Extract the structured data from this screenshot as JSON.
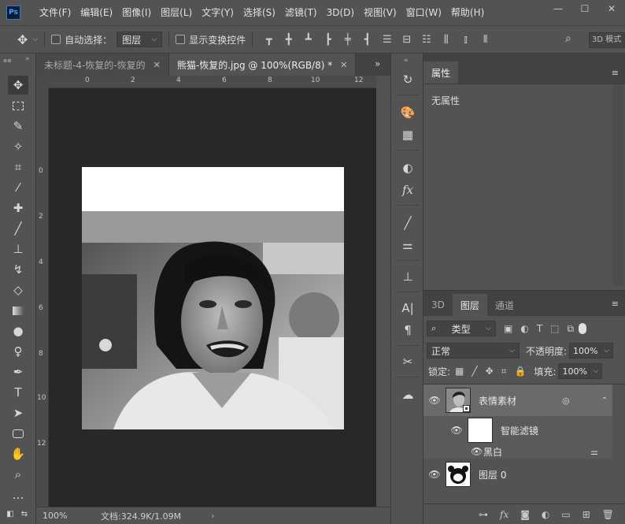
{
  "app": {
    "logo": "Ps",
    "menu": [
      "文件(F)",
      "编辑(E)",
      "图像(I)",
      "图层(L)",
      "文字(Y)",
      "选择(S)",
      "滤镜(T)",
      "3D(D)",
      "视图(V)",
      "窗口(W)",
      "帮助(H)"
    ],
    "window_controls": {
      "minimize": "—",
      "maximize": "☐",
      "close": "✕"
    }
  },
  "options": {
    "auto_select_label": "自动选择：",
    "auto_select_value": "图层",
    "show_transform_label": "显示变换控件",
    "three_d_label": "3D 模式"
  },
  "tabs": [
    {
      "label": "未标题-4-恢复的-恢复的",
      "close": "✕"
    },
    {
      "label": "熊猫-恢复的.jpg @ 100%(RGB/8) *",
      "close": "✕"
    }
  ],
  "tabs_more": "»",
  "ruler": {
    "top_ticks": [
      "0",
      "2",
      "4",
      "6",
      "8",
      "10",
      "12"
    ],
    "left_ticks": [
      "0",
      "2",
      "4",
      "6",
      "8",
      "10",
      "12"
    ]
  },
  "status": {
    "zoom": "100%",
    "doc": "文档:324.9K/1.09M",
    "arrow": "›"
  },
  "properties": {
    "tab": "属性",
    "empty_text": "无属性",
    "menu_icon": "≡"
  },
  "layers": {
    "tabs": [
      "3D",
      "图层",
      "通道"
    ],
    "menu_icon": "≡",
    "kind_filter": "类型",
    "blend_mode": "正常",
    "opacity_label": "不透明度:",
    "opacity_value": "100%",
    "lock_label": "锁定:",
    "fill_label": "填充:",
    "fill_value": "100%",
    "items": [
      {
        "name": "表情素材",
        "selected": true
      },
      {
        "name": "智能滤镜"
      },
      {
        "name": "黑白"
      },
      {
        "name": "图层 0"
      }
    ]
  }
}
